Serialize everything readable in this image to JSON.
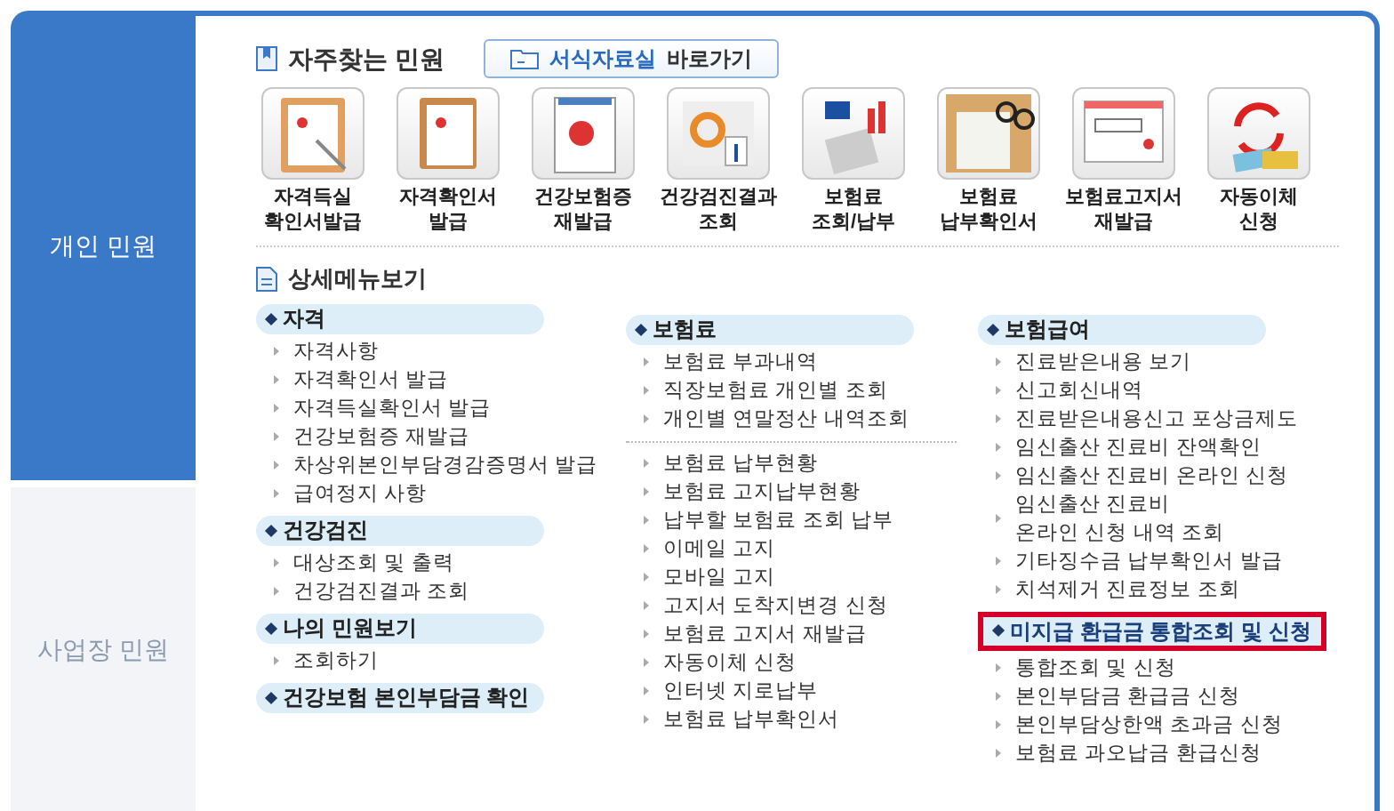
{
  "sidebar": {
    "tabs": [
      {
        "label": "개인 민원",
        "selected": true
      },
      {
        "label": "사업장 민원",
        "selected": false
      }
    ]
  },
  "frequent": {
    "title": "자주찾는 민원",
    "button": {
      "highlight": "서식자료실",
      "rest": "바로가기"
    },
    "tiles": [
      {
        "label": "자격득실\n확인서발급"
      },
      {
        "label": "자격확인서\n발급"
      },
      {
        "label": "건강보험증\n재발급"
      },
      {
        "label": "건강검진결과\n조회"
      },
      {
        "label": "보험료\n조회/납부"
      },
      {
        "label": "보험료\n납부확인서"
      },
      {
        "label": "보험료고지서\n재발급"
      },
      {
        "label": "자동이체\n신청"
      }
    ]
  },
  "detail": {
    "title": "상세메뉴보기",
    "columns": [
      {
        "sections": [
          {
            "title": "자격",
            "highlighted": false,
            "item_groups": [
              [
                "자격사항",
                "자격확인서 발급",
                "자격득실확인서 발급",
                "건강보험증 재발급",
                "차상위본인부담경감증명서 발급",
                "급여정지 사항"
              ]
            ]
          },
          {
            "title": "건강검진",
            "highlighted": false,
            "item_groups": [
              [
                "대상조회 및 출력",
                "건강검진결과 조회"
              ]
            ]
          },
          {
            "title": "나의 민원보기",
            "highlighted": false,
            "item_groups": [
              [
                "조회하기"
              ]
            ]
          },
          {
            "title": "건강보험 본인부담금 확인",
            "highlighted": false
          }
        ]
      },
      {
        "sections": [
          {
            "title": "보험료",
            "highlighted": false,
            "item_groups": [
              [
                "보험료 부과내역",
                "직장보험료 개인별 조회",
                "개인별 연말정산 내역조회"
              ],
              [
                "보험료 납부현황",
                "보험료 고지납부현황",
                "납부할 보험료 조회 납부",
                "이메일 고지",
                "모바일 고지",
                "고지서 도착지변경 신청",
                "보험료 고지서 재발급",
                "자동이체 신청",
                "인터넷 지로납부",
                "보험료 납부확인서"
              ]
            ]
          }
        ]
      },
      {
        "sections": [
          {
            "title": "보험급여",
            "highlighted": false,
            "item_groups": [
              [
                "진료받은내용 보기",
                "신고회신내역",
                "진료받은내용신고 포상금제도",
                "임신출산 진료비 잔액확인",
                "임신출산 진료비 온라인 신청",
                "임신출산 진료비\n온라인 신청 내역 조회",
                "기타징수금 납부확인서 발급",
                "치석제거 진료정보 조회"
              ]
            ]
          },
          {
            "title": "미지급 환급금 통합조회 및 신청",
            "highlighted": true,
            "item_groups": [
              [
                "통합조회 및 신청",
                "본인부담금 환급금 신청",
                "본인부담상한액 초과금 신청",
                "보험료 과오납금 환급신청"
              ]
            ]
          }
        ]
      }
    ]
  }
}
